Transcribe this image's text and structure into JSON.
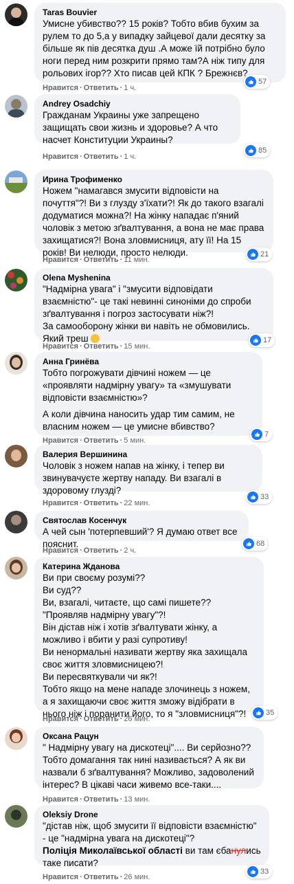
{
  "actions": {
    "like": "Нравится",
    "reply": "Ответить",
    "dot": "·"
  },
  "comments": [
    {
      "author": "Taras Bouvier",
      "text": "Умисне убивство?? 15 років? Тобто вбив бухим за рулем то до 5,а у випадку зайцевої дали десятку за більше як пів десятка душ .А може їй потрібно було ноги перед ним розкрити прямо там?А ніж типу для рольових ігор?? Хто писав цей КПК ? Брежнєв?",
      "time": "1 ч.",
      "reactions": "57"
    },
    {
      "author": "Andrey Osadchiy",
      "text": "Гражданам Украины уже запрещено защищать свои жизнь и здоровье? А что насчет Конституции Украины?",
      "time": "1 ч.",
      "reactions": "85"
    },
    {
      "author": "Ирина Трофименко",
      "text": "Ножем \"намагався змусити відповісти на почуття\"?! Ви з глузду з'їхати?! Як до такого взагалі додуматися можна?! На жінку нападає п'яний чоловік з метою зґвалтування, а вона не має права захищатися?! Вона зловмисниця, ату її! На 15 років! Ви нелюди, просто нелюди.",
      "time": "11 мин.",
      "reactions": "21"
    },
    {
      "author": "Olena Myshenina",
      "text": "\"Надмірна увага\" і \"змусити відповідати взаємністю\"- це такі невинні синоніми до спроби зґвалтування і погроз застосувати ніж?!",
      "text2": "За самооборону жінки ви навіть не обмовились. Який треш",
      "time": "15 мин.",
      "reactions": "17"
    },
    {
      "author": "Анна Гринёва",
      "text": "Тобто погрожувати дівчині ножем — це «проявляти надмірну увагу» та «змушувати відповісти взаємністю»?",
      "text2": "А коли дівчина наносить удар тим самим, не власним ножем — це умисне вбивство?",
      "time": "5 мин.",
      "reactions": "7"
    },
    {
      "author": "Валерия Вершинина",
      "text": "Чоловік з ножем напав на жінку, і тепер ви звинувачуєте жертву нападу. Ви взагалі в здоровому глузді?",
      "time": "22 мин.",
      "reactions": "33"
    },
    {
      "author": "Святослав Косенчук",
      "text": "А чей сын 'потерпевший'? Я думаю ответ все пояснит.",
      "time": "2 ч.",
      "reactions": "68"
    },
    {
      "author": "Катерина Жданова",
      "lines": [
        "Ви при своєму розумі??",
        "Ви суд??",
        "Ви, взагалі, читаєте, що самі пишете??",
        "\"Проявляв надмірну увагу\"?!",
        "Він дістав ніж і хотів зґвалтувати жінку, а можливо і вбити у разі супротиву!",
        "Ви ненормальні називати жертву яка захищала своє життя зловмисницею?!",
        "Ви пересвяткували чи як?!",
        "Тобто якщо на мене нападе злочинець з ножем, а я захищаючи своє життя зможу відібрати в нього ніж і поранити його, то я \"зловмисниця\"?!"
      ],
      "time": "26 мин.",
      "reactions": "35"
    },
    {
      "author": "Оксана Рацун",
      "text": "\" Надмірну увагу на дискотеці\".... Ви серйозно?? Тобто домагання так нині називається? А як ви назвали б зґвалтування? Можливо, задоволений інтерес? В цікаві часи живемо все-таки....",
      "time": "13 мин.",
      "reactions": ""
    },
    {
      "author": "Oleksiy Drone",
      "text": "\"дістав ніж, щоб змусити її відповісти взаємністю\" - це \"надмірна увага на дискотеці\"?",
      "mention": "Поліція Миколаївської області",
      "text_pre": " ви там єба",
      "text_censor": "нул",
      "text_post": "ись таке писати?",
      "time": "26 мин.",
      "reactions": "33"
    }
  ],
  "colors": {
    "bubble": "#f0f2f5",
    "like": "#1877f2",
    "meta": "#65676b",
    "censor": "#e0251b"
  },
  "icons": {
    "reaction": "like-thumb-icon",
    "emoji": "face-emoji-icon"
  }
}
